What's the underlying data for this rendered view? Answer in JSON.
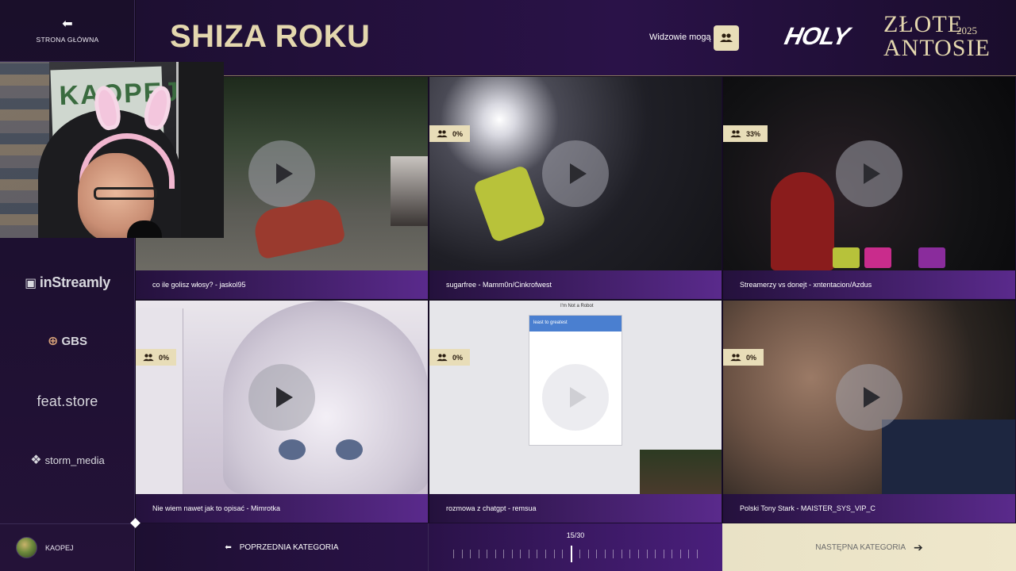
{
  "sidebar": {
    "home_label": "STRONA GŁÓWNA",
    "sponsors": [
      "inStreamly",
      "GBS",
      "feat.store",
      "storm_media"
    ],
    "user_name": "KAOPEJ"
  },
  "header": {
    "title": "SHIZA ROKU",
    "viewers_label": "Widzowie mogą",
    "logo_holy": "HOLY",
    "logo_line1": "ZŁOTE",
    "logo_line2": "ANTOSIE",
    "logo_year": "2025"
  },
  "clips": [
    {
      "caption": "co ile golisz włosy? - jaskol95",
      "votes": ""
    },
    {
      "caption": "sugarfree - Mamm0n/Cinkrofwest",
      "votes": "0%"
    },
    {
      "caption": "Streamerzy vs donejt - xntentacion/Azdus",
      "votes": "33%"
    },
    {
      "caption": "Nie wiem nawet jak to opisać - Mimrotka",
      "votes": "0%"
    },
    {
      "caption": "rozmowa z chatgpt - remsua",
      "votes": "0%"
    },
    {
      "caption": "Polski Tony Stark - MAISTER_SYS_VIP_C",
      "votes": "0%"
    }
  ],
  "captcha": {
    "title": "I'm Not a Robot",
    "prompt": "least to greatest"
  },
  "webcam": {
    "sign": "KAOPEJ"
  },
  "footer": {
    "prev_label": "POPRZEDNIA KATEGORIA",
    "next_label": "NASTĘPNA KATEGORIA",
    "progress": "15/30",
    "current": 15,
    "total": 30
  },
  "colors": {
    "gold": "#e4d7ae",
    "badge": "#e8ddb8",
    "purple": "#5a2a8c",
    "background": "#120a1e"
  }
}
